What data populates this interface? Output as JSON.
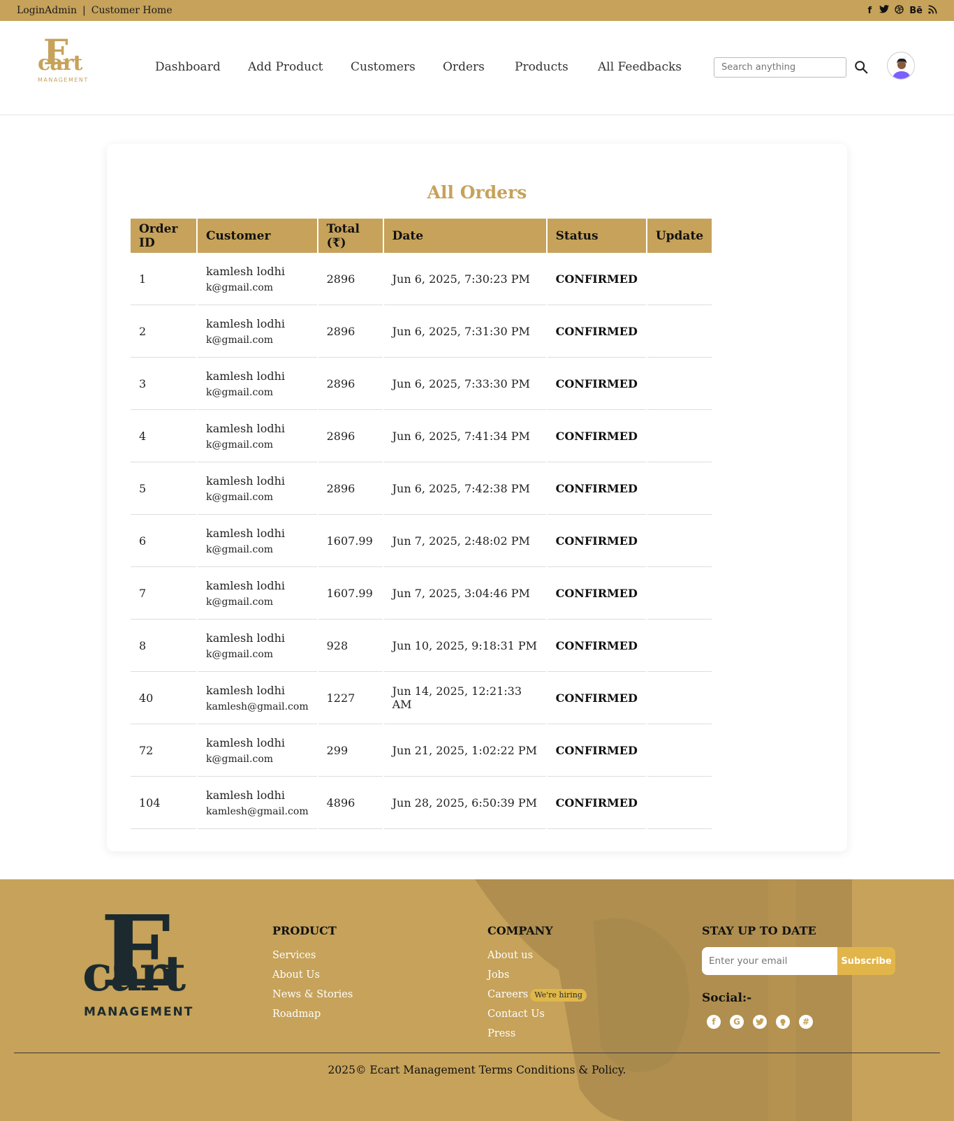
{
  "topbar": {
    "login_admin": "LoginAdmin",
    "separator": "|",
    "customer_home": "Customer Home",
    "social": [
      "f",
      "t",
      "d",
      "Bē",
      "rss"
    ]
  },
  "logo": {
    "e": "E",
    "cart": "cart",
    "mgmt": "MANAGEMENT"
  },
  "nav": [
    "Dashboard",
    "Add Product",
    "Customers",
    "Orders",
    "Products",
    "All Feedbacks"
  ],
  "search": {
    "placeholder": "Search anything"
  },
  "main": {
    "title": "All Orders",
    "columns": [
      "Order ID",
      "Customer",
      "Total (₹)",
      "Date",
      "Status",
      "Update"
    ],
    "rows": [
      {
        "id": "1",
        "name": "kamlesh lodhi",
        "email": "k@gmail.com",
        "total": "2896",
        "date": "Jun 6, 2025, 7:30:23 PM",
        "status": "CONFIRMED"
      },
      {
        "id": "2",
        "name": "kamlesh lodhi",
        "email": "k@gmail.com",
        "total": "2896",
        "date": "Jun 6, 2025, 7:31:30 PM",
        "status": "CONFIRMED"
      },
      {
        "id": "3",
        "name": "kamlesh lodhi",
        "email": "k@gmail.com",
        "total": "2896",
        "date": "Jun 6, 2025, 7:33:30 PM",
        "status": "CONFIRMED"
      },
      {
        "id": "4",
        "name": "kamlesh lodhi",
        "email": "k@gmail.com",
        "total": "2896",
        "date": "Jun 6, 2025, 7:41:34 PM",
        "status": "CONFIRMED"
      },
      {
        "id": "5",
        "name": "kamlesh lodhi",
        "email": "k@gmail.com",
        "total": "2896",
        "date": "Jun 6, 2025, 7:42:38 PM",
        "status": "CONFIRMED"
      },
      {
        "id": "6",
        "name": "kamlesh lodhi",
        "email": "k@gmail.com",
        "total": "1607.99",
        "date": "Jun 7, 2025, 2:48:02 PM",
        "status": "CONFIRMED"
      },
      {
        "id": "7",
        "name": "kamlesh lodhi",
        "email": "k@gmail.com",
        "total": "1607.99",
        "date": "Jun 7, 2025, 3:04:46 PM",
        "status": "CONFIRMED"
      },
      {
        "id": "8",
        "name": "kamlesh lodhi",
        "email": "k@gmail.com",
        "total": "928",
        "date": "Jun 10, 2025, 9:18:31 PM",
        "status": "CONFIRMED"
      },
      {
        "id": "40",
        "name": "kamlesh lodhi",
        "email": "kamlesh@gmail.com",
        "total": "1227",
        "date": "Jun 14, 2025, 12:21:33 AM",
        "status": "CONFIRMED"
      },
      {
        "id": "72",
        "name": "kamlesh lodhi",
        "email": "k@gmail.com",
        "total": "299",
        "date": "Jun 21, 2025, 1:02:22 PM",
        "status": "CONFIRMED"
      },
      {
        "id": "104",
        "name": "kamlesh lodhi",
        "email": "kamlesh@gmail.com",
        "total": "4896",
        "date": "Jun 28, 2025, 6:50:39 PM",
        "status": "CONFIRMED"
      }
    ]
  },
  "footer": {
    "product_heading": "PRODUCT",
    "product_links": [
      "Services",
      "About Us",
      "News & Stories",
      "Roadmap"
    ],
    "company_heading": "COMPANY",
    "company_links": [
      "About us",
      "Jobs",
      "Careers",
      "Contact Us",
      "Press"
    ],
    "hiring_badge": "We're hiring",
    "stay_heading": "STAY UP TO DATE",
    "email_placeholder": "Enter your email",
    "subscribe_label": "Subscribe",
    "social_label": "Social:-",
    "social_icons": [
      "f",
      "G",
      "t",
      "gh",
      "#"
    ],
    "copyright": "2025© Ecart Management Terms Conditions & Policy."
  },
  "colors": {
    "accent": "#c6a25a",
    "dark": "#1c2a2f",
    "button": "#e2b54b"
  }
}
